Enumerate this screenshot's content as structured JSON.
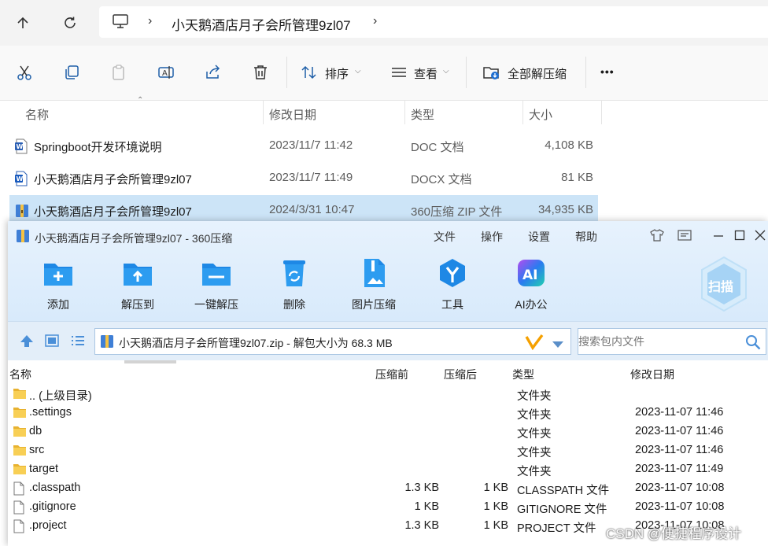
{
  "explorer": {
    "path": "小天鹅酒店月子会所管理9zl07",
    "toolbar": {
      "sort_label": "排序",
      "view_label": "查看",
      "extract_all_label": "全部解压缩",
      "more_label": "•••"
    },
    "columns": {
      "name": "名称",
      "date": "修改日期",
      "type": "类型",
      "size": "大小"
    },
    "files": [
      {
        "name": "Springboot开发环境说明",
        "date": "2023/11/7 11:42",
        "type": "DOC 文档",
        "size": "4,108 KB",
        "icon": "word-doc-icon"
      },
      {
        "name": "小天鹅酒店月子会所管理9zl07",
        "date": "2023/11/7 11:49",
        "type": "DOCX 文档",
        "size": "81 KB",
        "icon": "word-docx-icon"
      },
      {
        "name": "小天鹅酒店月子会所管理9zl07",
        "date": "2024/3/31 10:47",
        "type": "360压缩 ZIP 文件",
        "size": "34,935 KB",
        "icon": "zip-archive-icon"
      }
    ]
  },
  "zipwin": {
    "title": "小天鹅酒店月子会所管理9zl07 - 360压缩",
    "menu": [
      "文件",
      "操作",
      "设置",
      "帮助"
    ],
    "tools": [
      {
        "label": "添加",
        "icon": "add-icon"
      },
      {
        "label": "解压到",
        "icon": "extract-to-icon"
      },
      {
        "label": "一键解压",
        "icon": "one-click-extract-icon"
      },
      {
        "label": "删除",
        "icon": "delete-icon"
      },
      {
        "label": "图片压缩",
        "icon": "image-compress-icon"
      },
      {
        "label": "工具",
        "icon": "tools-icon"
      },
      {
        "label": "AI办公",
        "icon": "ai-office-icon"
      }
    ],
    "scan_label": "扫描",
    "path_text": "小天鹅酒店月子会所管理9zl07.zip - 解包大小为 68.3 MB",
    "search_placeholder": "搜索包内文件",
    "columns": {
      "name": "名称",
      "before": "压缩前",
      "after": "压缩后",
      "type": "类型",
      "date": "修改日期"
    },
    "entries": [
      {
        "name": ".. (上级目录)",
        "before": "",
        "after": "",
        "type": "文件夹",
        "date": "",
        "icon": "folder-icon"
      },
      {
        "name": ".settings",
        "before": "",
        "after": "",
        "type": "文件夹",
        "date": "2023-11-07 11:46",
        "icon": "folder-icon"
      },
      {
        "name": "db",
        "before": "",
        "after": "",
        "type": "文件夹",
        "date": "2023-11-07 11:46",
        "icon": "folder-icon"
      },
      {
        "name": "src",
        "before": "",
        "after": "",
        "type": "文件夹",
        "date": "2023-11-07 11:46",
        "icon": "folder-icon"
      },
      {
        "name": "target",
        "before": "",
        "after": "",
        "type": "文件夹",
        "date": "2023-11-07 11:49",
        "icon": "folder-icon"
      },
      {
        "name": ".classpath",
        "before": "1.3 KB",
        "after": "1 KB",
        "type": "CLASSPATH 文件",
        "date": "2023-11-07 10:08",
        "icon": "file-icon"
      },
      {
        "name": ".gitignore",
        "before": "1 KB",
        "after": "1 KB",
        "type": "GITIGNORE 文件",
        "date": "2023-11-07 10:08",
        "icon": "file-icon"
      },
      {
        "name": ".project",
        "before": "1.3 KB",
        "after": "1 KB",
        "type": "PROJECT 文件",
        "date": "2023-11-07 10:08",
        "icon": "file-icon"
      }
    ]
  },
  "watermark": "CSDN @便捷程序设计"
}
